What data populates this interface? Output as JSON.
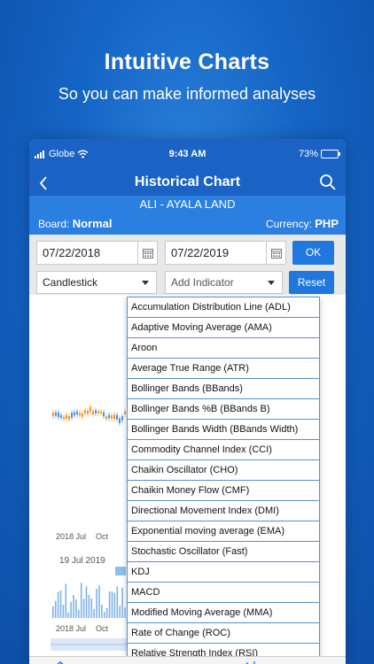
{
  "promo": {
    "title": "Intuitive Charts",
    "subtitle": "So you can make informed analyses"
  },
  "status_bar": {
    "carrier": "Globe",
    "time": "9:43 AM",
    "battery": "73%"
  },
  "nav": {
    "title": "Historical Chart"
  },
  "stock": {
    "name": "ALI - AYALA LAND",
    "board_label": "Board:",
    "board_value": "Normal",
    "currency_label": "Currency:",
    "currency_value": "PHP"
  },
  "controls": {
    "start_date": "07/22/2018",
    "end_date": "07/22/2019",
    "ok_label": "OK",
    "chart_type": "Candlestick",
    "indicator_placeholder": "Add Indicator",
    "reset_label": "Reset"
  },
  "chart": {
    "x_ticks": [
      "2018 Jul",
      "Oct"
    ],
    "selected_date": "19 Jul 2019",
    "bottom_ticks": [
      "2018 Jul",
      "Oct"
    ]
  },
  "indicators": [
    "Accumulation Distribution Line (ADL)",
    "Adaptive Moving Average (AMA)",
    "Aroon",
    "Average True Range (ATR)",
    "Bollinger Bands (BBands)",
    "Bollinger Bands %B (BBands B)",
    "Bollinger Bands Width (BBands Width)",
    "Commodity Channel Index (CCI)",
    "Chaikin Oscillator (CHO)",
    "Chaikin Money Flow (CMF)",
    "Directional Movement Index (DMI)",
    "Exponential moving average (EMA)",
    "Stochastic Oscillator (Fast)",
    "KDJ",
    "MACD",
    "Modified Moving Average (MMA)",
    "Rate of Change (ROC)",
    "Relative Strength Index (RSI)"
  ],
  "colors": {
    "header_blue": "#1a62c4",
    "accent_blue": "#1e78de",
    "candle_up": "#4a90d9",
    "candle_down": "#f0932b"
  }
}
